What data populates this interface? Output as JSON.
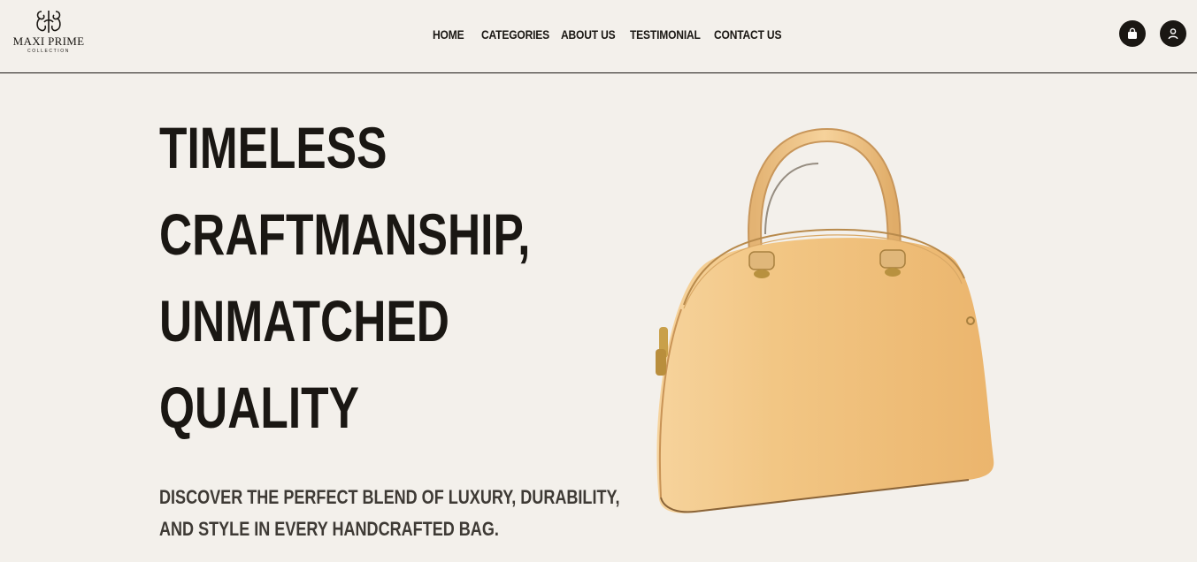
{
  "brand": {
    "name": "MAXI PRIME",
    "tagline": "COLLECTION"
  },
  "nav": {
    "items": [
      {
        "label": "HOME"
      },
      {
        "label": "CATEGORIES"
      },
      {
        "label": "ABOUT US"
      },
      {
        "label": "TESTIMONIAL"
      },
      {
        "label": "CONTACT US"
      }
    ]
  },
  "header_icons": {
    "cart": "shopping-bag-icon",
    "account": "user-icon"
  },
  "hero": {
    "title_lines": [
      "TIMELESS",
      "CRAFTMANSHIP,",
      "UNMATCHED",
      "QUALITY"
    ],
    "subtitle_lines": [
      "DISCOVER THE PERFECT BLEND OF LUXURY, DURABILITY,",
      "AND STYLE IN EVERY HANDCRAFTED BAG."
    ],
    "image": "tan-handbag"
  },
  "colors": {
    "background": "#f3f0eb",
    "text": "#1a1713",
    "bag": "#f0c27f"
  }
}
